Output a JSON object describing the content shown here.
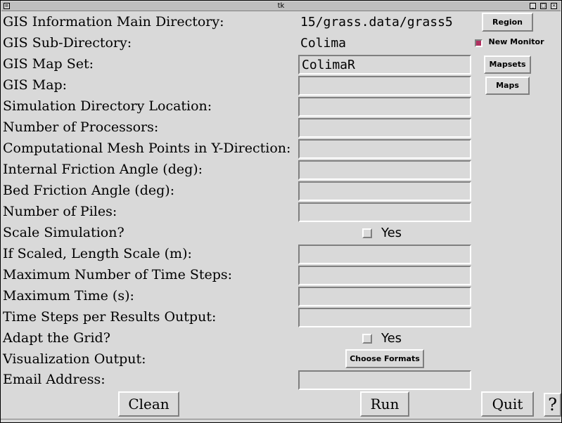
{
  "window": {
    "title": "tk",
    "menu_icon": "≡",
    "minimize_icon": "_",
    "maximize_icon": "□",
    "close_icon": "×"
  },
  "rows": [
    {
      "label": "GIS Information Main Directory:",
      "value": "15/grass.data/grass5"
    },
    {
      "label": "GIS Sub-Directory:",
      "value": "Colima"
    },
    {
      "label": "GIS Map Set:",
      "value": "ColimaR"
    },
    {
      "label": "GIS Map:",
      "value": ""
    },
    {
      "label": "Simulation Directory Location:",
      "value": ""
    },
    {
      "label": "Number of Processors:",
      "value": ""
    },
    {
      "label": "Computational Mesh Points in Y-Direction:",
      "value": ""
    },
    {
      "label": "Internal Friction Angle (deg):",
      "value": ""
    },
    {
      "label": "Bed Friction Angle (deg):",
      "value": ""
    },
    {
      "label": "Number of Piles:",
      "value": ""
    },
    {
      "label": "Scale Simulation?",
      "value": ""
    },
    {
      "label": "If Scaled, Length Scale (m):",
      "value": ""
    },
    {
      "label": "Maximum Number of Time Steps:",
      "value": ""
    },
    {
      "label": "Maximum Time (s):",
      "value": ""
    },
    {
      "label": "Time Steps per Results Output:",
      "value": ""
    },
    {
      "label": "Adapt the Grid?",
      "value": ""
    },
    {
      "label": "Visualization Output:",
      "value": ""
    },
    {
      "label": "Email Address:",
      "value": ""
    }
  ],
  "side": {
    "region": "Region",
    "new_monitor": "New Monitor",
    "mapsets": "Mapsets",
    "maps": "Maps"
  },
  "scale_yes": "Yes",
  "adapt_yes": "Yes",
  "choose_formats": "Choose Formats",
  "buttons": {
    "clean": "Clean",
    "run": "Run",
    "quit": "Quit",
    "help": "?"
  }
}
